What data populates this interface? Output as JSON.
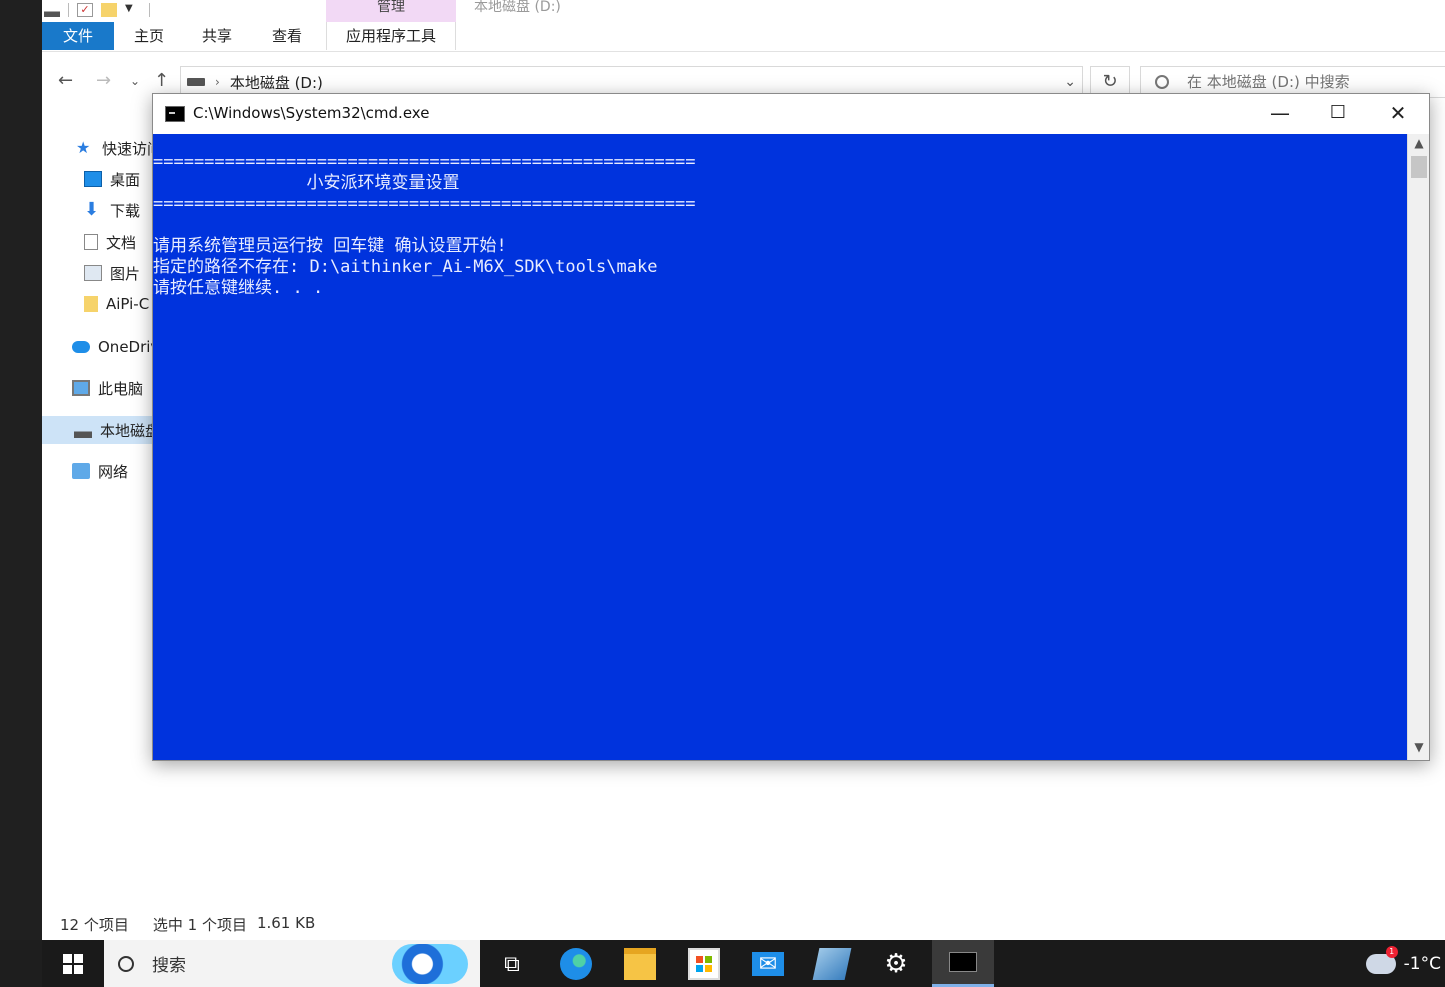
{
  "explorer": {
    "context_tab": "管理",
    "window_title": "本地磁盘 (D:)",
    "ribbon_tabs": [
      "文件",
      "主页",
      "共享",
      "查看",
      "应用程序工具"
    ],
    "address_path": "本地磁盘 (D:)",
    "search_placeholder": "在 本地磁盘 (D:) 中搜索",
    "nav": [
      {
        "label": "快速访问",
        "icon": "star-icon"
      },
      {
        "label": "桌面",
        "icon": "desktop-icon"
      },
      {
        "label": "下载",
        "icon": "download-icon"
      },
      {
        "label": "文档",
        "icon": "document-icon"
      },
      {
        "label": "图片",
        "icon": "pictures-icon"
      },
      {
        "label": "AiPi-C",
        "icon": "folder-icon"
      },
      {
        "label": "OneDrive",
        "icon": "onedrive-icon"
      },
      {
        "label": "此电脑",
        "icon": "computer-icon"
      },
      {
        "label": "本地磁盘",
        "icon": "drive-icon"
      },
      {
        "label": "网络",
        "icon": "network-icon"
      }
    ],
    "status_items": "12 个项目",
    "status_selected": "选中 1 个项目",
    "status_size": "1.61 KB"
  },
  "cmd": {
    "title": "C:\\Windows\\System32\\cmd.exe",
    "lines": [
      "=====================================================",
      "               小安派环境变量设置",
      "=====================================================",
      "",
      "请用系统管理员运行按 回车键 确认设置开始!",
      "指定的路径不存在: D:\\aithinker_Ai-M6X_SDK\\tools\\make",
      "请按任意键继续. . ."
    ]
  },
  "taskbar": {
    "search_label": "搜索",
    "temperature": "-1°C",
    "notification_count": "1",
    "colors": {
      "console_bg": "#0033dd",
      "file_tab": "#1979ca"
    }
  }
}
